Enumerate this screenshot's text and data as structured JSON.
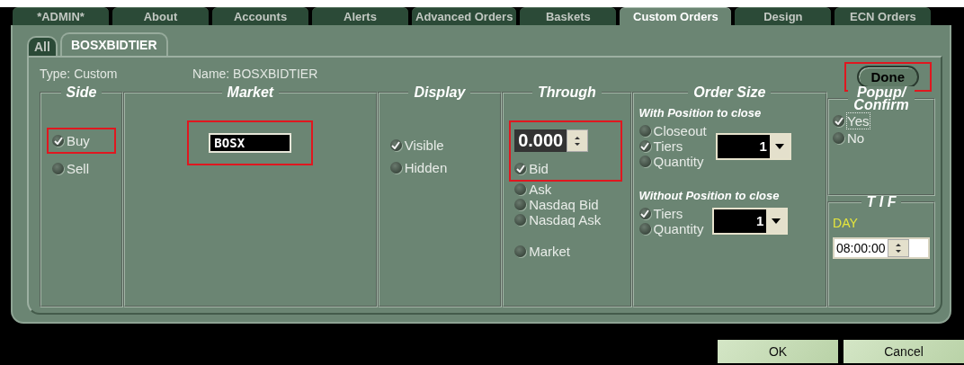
{
  "tabs": [
    {
      "label": "*ADMIN*",
      "selected": false
    },
    {
      "label": "About",
      "selected": false
    },
    {
      "label": "Accounts",
      "selected": false
    },
    {
      "label": "Alerts",
      "selected": false
    },
    {
      "label": "Advanced Orders",
      "selected": false
    },
    {
      "label": "Baskets",
      "selected": false
    },
    {
      "label": "Custom Orders",
      "selected": true
    },
    {
      "label": "Design",
      "selected": false
    },
    {
      "label": "ECN Orders",
      "selected": false
    }
  ],
  "subtabs": [
    {
      "label": "All",
      "selected": false
    },
    {
      "label": "BOSXBIDTIER",
      "selected": true
    }
  ],
  "header": {
    "type": "Type: Custom",
    "name": "Name: BOSXBIDTIER",
    "done": {
      "label": "Done",
      "highlighted": true
    }
  },
  "side": {
    "title": "Side",
    "options": [
      {
        "label": "Buy",
        "selected": true,
        "highlighted": true
      },
      {
        "label": "Sell",
        "selected": false,
        "highlighted": false
      }
    ]
  },
  "market": {
    "title": "Market",
    "value": "BOSX",
    "highlighted": true
  },
  "display": {
    "title": "Display",
    "options": [
      {
        "label": "Visible",
        "selected": true
      },
      {
        "label": "Hidden",
        "selected": false
      }
    ]
  },
  "through": {
    "title": "Through",
    "price": "0.000",
    "highlighted": true,
    "options": [
      {
        "label": "Bid",
        "selected": true
      },
      {
        "label": "Ask",
        "selected": false
      },
      {
        "label": "Nasdaq Bid",
        "selected": false
      },
      {
        "label": "Nasdaq Ask",
        "selected": false
      }
    ],
    "lower_options": [
      {
        "label": "Market",
        "selected": false
      }
    ]
  },
  "order_size": {
    "title": "Order Size",
    "sections": [
      {
        "heading": "With Position to close",
        "quantity": "1",
        "options": [
          {
            "label": "Closeout",
            "selected": false
          },
          {
            "label": "Tiers",
            "selected": true
          },
          {
            "label": "Quantity",
            "selected": false
          }
        ]
      },
      {
        "heading": "Without Position to close",
        "quantity": "1",
        "options": [
          {
            "label": "Tiers",
            "selected": true
          },
          {
            "label": "Quantity",
            "selected": false
          }
        ]
      }
    ]
  },
  "popup": {
    "title_lines": [
      "Popup/",
      "Confirm"
    ],
    "options": [
      {
        "label": "Yes",
        "selected": true,
        "focused": true
      },
      {
        "label": "No",
        "selected": false,
        "focused": false
      }
    ]
  },
  "tif": {
    "title": "T I F",
    "day": "DAY",
    "time": "08:00:00"
  },
  "buttons": [
    {
      "label": "OK"
    },
    {
      "label": "Cancel"
    }
  ]
}
